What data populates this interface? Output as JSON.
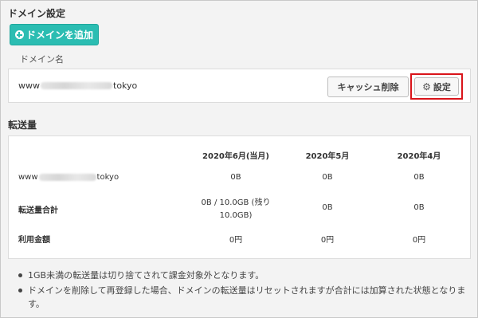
{
  "domain_settings": {
    "title": "ドメイン設定",
    "add_button_label": "ドメインを追加",
    "column_label": "ドメイン名",
    "domain_prefix": "www",
    "domain_suffix": "tokyo",
    "cache_button_label": "キャッシュ削除",
    "settings_button_label": "設定",
    "highlight_color": "#d9141a",
    "accent_color": "#2bbdb2"
  },
  "traffic": {
    "title": "転送量",
    "columns": [
      "2020年6月(当月)",
      "2020年5月",
      "2020年4月"
    ],
    "rows": [
      {
        "label_prefix": "www",
        "label_suffix": "tokyo",
        "values": [
          "0B",
          "0B",
          "0B"
        ]
      },
      {
        "label": "転送量合計",
        "values": [
          "0B / 10.0GB (残り",
          "10.0GB)",
          "0B",
          "0B"
        ]
      },
      {
        "label": "利用金額",
        "values": [
          "0円",
          "0円",
          "0円"
        ]
      }
    ]
  },
  "notes": [
    "1GB未満の転送量は切り捨てされて課金対象外となります。",
    "ドメインを削除して再登録した場合、ドメインの転送量はリセットされますが合計には加算された状態となります。"
  ]
}
